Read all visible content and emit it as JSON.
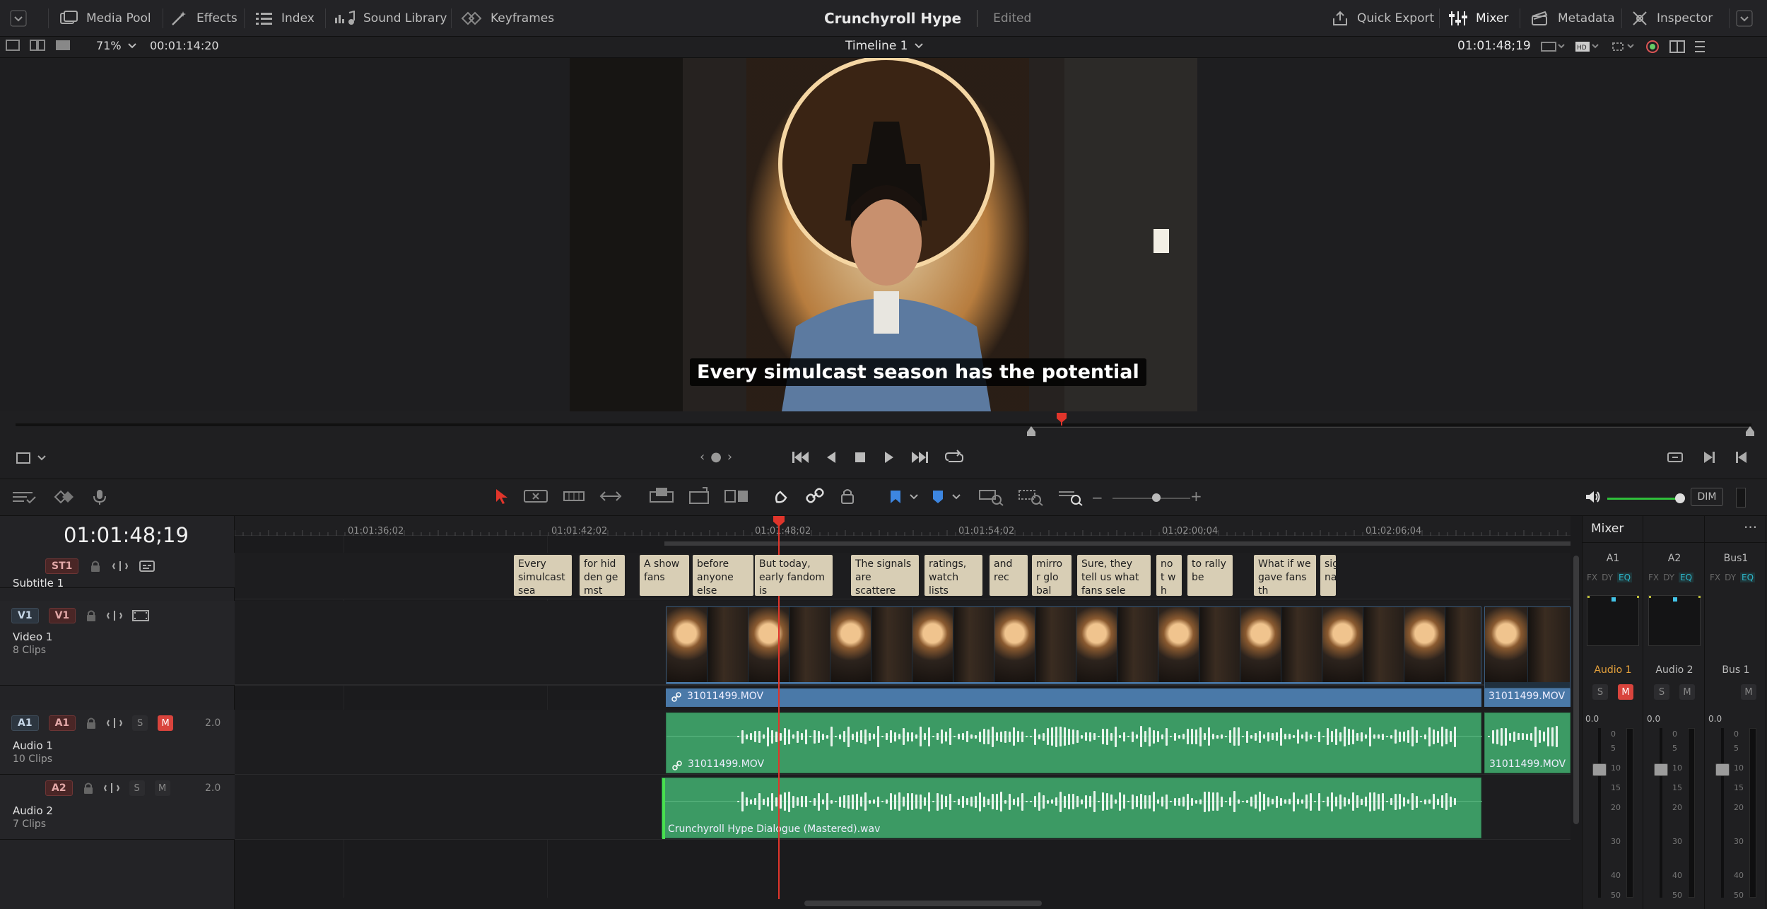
{
  "topbar": {
    "media_pool": "Media Pool",
    "effects": "Effects",
    "index": "Index",
    "sound_library": "Sound Library",
    "keyframes": "Keyframes",
    "project_title": "Crunchyroll Hype",
    "project_status": "Edited",
    "quick_export": "Quick Export",
    "mixer": "Mixer",
    "metadata": "Metadata",
    "inspector": "Inspector"
  },
  "viewerbar": {
    "zoom": "71%",
    "source_timecode": "00:01:14:20",
    "timeline_name": "Timeline 1",
    "record_timecode": "01:01:48;19"
  },
  "viewer": {
    "subtitle_text": "Every simulcast season has the potential"
  },
  "toolbar": {
    "dim_label": "DIM"
  },
  "timeline": {
    "current_timecode": "01:01:48;19",
    "ruler_labels": [
      "01:01:36;02",
      "01:01:42;02",
      "01:01:48;02",
      "01:01:54;02",
      "01:02:00;04",
      "01:02:06;04"
    ],
    "tracks": {
      "subtitle": {
        "badge": "ST1",
        "name": "Subtitle 1"
      },
      "video": {
        "badge_src": "V1",
        "badge_dst": "V1",
        "name": "Video 1",
        "clips": "8 Clips"
      },
      "audio1": {
        "badge_src": "A1",
        "badge_dst": "A1",
        "name": "Audio 1",
        "clips": "10 Clips",
        "level": "2.0",
        "solo": "S",
        "mute": "M"
      },
      "audio2": {
        "badge_dst": "A2",
        "name": "Audio 2",
        "clips": "7 Clips",
        "level": "2.0",
        "solo": "S",
        "mute": "M"
      }
    },
    "subtitle_clips": [
      "Every simulcast sea",
      "for hid den ge mst",
      "A show fans",
      "before anyone else",
      "But today, early fandom is",
      "The signals are scattere",
      "ratings, watch lists",
      "and rec",
      "mirro r glo bal",
      "Sure, they tell us what fans sele",
      "no t w h",
      "to rally be",
      "What if we gave fans th",
      "sig nal"
    ],
    "video_clip_label_1": "31011499.MOV",
    "video_clip_label_2": "31011499.MOV",
    "audio1_clip_label_1": "31011499.MOV",
    "audio1_clip_label_2": "31011499.MOV",
    "audio2_clip_label": "Crunchyroll Hype Dialogue (Mastered).wav"
  },
  "mixer": {
    "title": "Mixer",
    "channels": [
      "A1",
      "A2",
      "Bus1"
    ],
    "channel_names": [
      "Audio 1",
      "Audio 2",
      "Bus 1"
    ],
    "fx": "FX",
    "dy": "DY",
    "eq": "EQ",
    "solo": "S",
    "mute": "M",
    "level": "0.0",
    "scale": [
      "0",
      "5",
      "10",
      "15",
      "20",
      "30",
      "40",
      "50"
    ]
  },
  "colors": {
    "subtitle_clip": "#d8ceb5",
    "video_clip_bar": "#4a79a8",
    "audio_clip": "#3c9a64",
    "playhead": "#e0352b",
    "mute_active": "#d9443d",
    "volume_green": "#2fbf3a"
  }
}
